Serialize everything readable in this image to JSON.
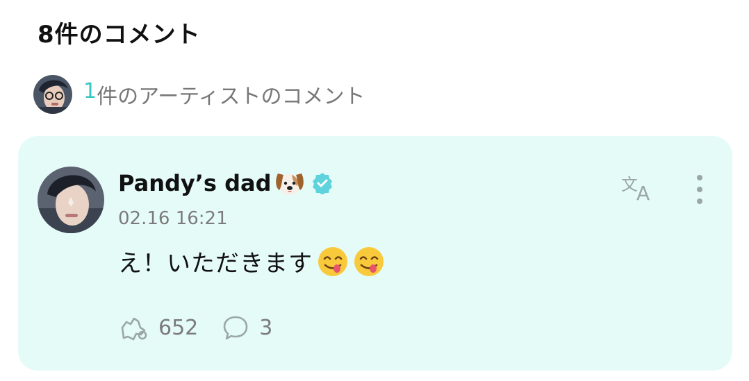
{
  "header": {
    "title": "8件のコメント"
  },
  "artist_summary": {
    "count": "1",
    "label": "件のアーティストのコメント"
  },
  "comment": {
    "author": "Pandy’s dad",
    "author_emoji": "dog-face",
    "verified": true,
    "timestamp": "02.16 16:21",
    "text": "え！いただきます",
    "emojis": [
      "face-savoring-food",
      "face-savoring-food"
    ],
    "likes": "652",
    "replies": "3"
  },
  "icons": {
    "translate": "translate-icon",
    "more": "more-vertical-icon",
    "like": "like-icon",
    "reply": "reply-bubble-icon",
    "verified": "verified-badge-icon"
  },
  "colors": {
    "accent": "#38c6c2",
    "card_background": "#e5fbf8",
    "muted_text": "#7b7b7b",
    "icon_gray": "#9aa6a8"
  }
}
